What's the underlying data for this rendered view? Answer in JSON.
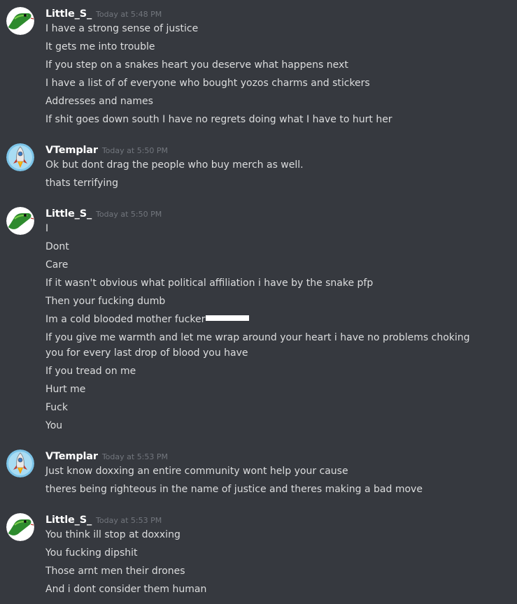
{
  "messages": [
    {
      "author": "Little_S_",
      "timestamp": "Today at 5:48 PM",
      "lines": [
        "I have a strong sense of justice",
        "It gets me into trouble",
        "If you step on a snakes heart you deserve what happens next",
        "I have a list of of everyone who bought yozos charms and stickers",
        "Addresses and names",
        "If shit goes down south I have no regrets doing what I have to hurt her"
      ]
    },
    {
      "author": "VTemplar",
      "timestamp": "Today at 5:50 PM",
      "lines": [
        "Ok but dont drag the people who buy merch as well.",
        "thats terrifying"
      ]
    },
    {
      "author": "Little_S_",
      "timestamp": "Today at 5:50 PM",
      "lines": [
        "I",
        "Dont",
        "Care",
        "If it wasn't obvious what political affiliation i have by the snake pfp",
        "Then your fucking dumb",
        "Im a cold blooded mother fucker",
        "If you give me warmth and let me wrap around your heart i have no problems choking you for every last drop of blood you have",
        "If you tread on me",
        "Hurt me",
        "Fuck",
        "You"
      ]
    },
    {
      "author": "VTemplar",
      "timestamp": "Today at 5:53 PM",
      "lines": [
        "Just know doxxing an entire community wont help your cause",
        "theres being righteous in the name of justice and theres making a bad move"
      ]
    },
    {
      "author": "Little_S_",
      "timestamp": "Today at 5:53 PM",
      "lines": [
        "You think ill stop at doxxing",
        "You fucking dipshit",
        "Those arnt men their drones",
        "And i dont consider them human"
      ]
    }
  ],
  "colors": {
    "background": "#36393f",
    "username": "#ffffff",
    "timestamp": "#72767d",
    "message_text": "#dcddde"
  },
  "icons": {
    "snake_avatar": "snake-avatar-icon",
    "rocket_avatar": "rocket-avatar-icon"
  }
}
